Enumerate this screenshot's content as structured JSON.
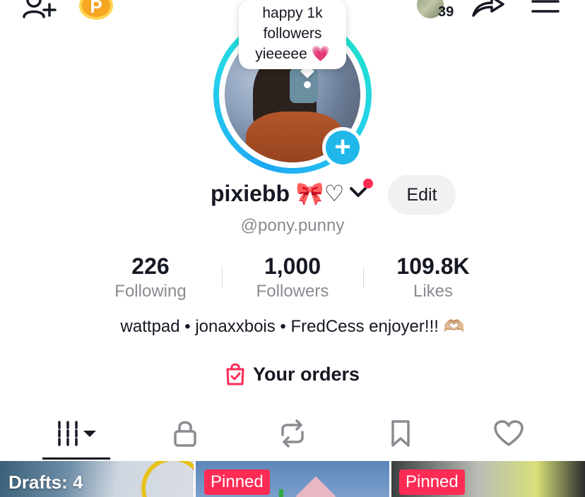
{
  "header": {
    "add_friend_icon": "person-plus-icon",
    "coin_letter": "P",
    "story_count": "39",
    "share_icon": "share-arrow-icon",
    "menu_icon": "hamburger-menu-icon"
  },
  "profile": {
    "status_bubble": [
      "happy 1k",
      "followers",
      "yieeeee 💗"
    ],
    "display_name": "pixiebb 🎀♡",
    "handle": "@pony.punny",
    "edit_label": "Edit",
    "bio": "wattpad • jonaxxbois • FredCess enjoyer!!! 🫶🏼"
  },
  "stats": [
    {
      "value": "226",
      "label": "Following"
    },
    {
      "value": "1,000",
      "label": "Followers"
    },
    {
      "value": "109.8K",
      "label": "Likes"
    }
  ],
  "orders": {
    "label": "Your orders"
  },
  "tabs": [
    {
      "icon": "grid-videos-icon",
      "active": true
    },
    {
      "icon": "lock-icon",
      "active": false
    },
    {
      "icon": "repost-icon",
      "active": false
    },
    {
      "icon": "bookmark-icon",
      "active": false
    },
    {
      "icon": "heart-icon",
      "active": false
    }
  ],
  "grid": {
    "drafts_label": "Drafts: 4",
    "pinned_label": "Pinned"
  },
  "colors": {
    "accent_red": "#fe2c55",
    "ring_cyan": "#20e3c2",
    "ring_blue": "#1ea7f5",
    "coin_gold": "#f5a623"
  }
}
